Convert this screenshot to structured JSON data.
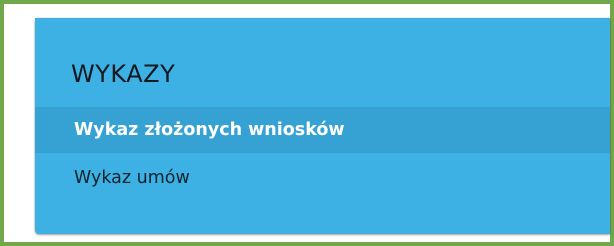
{
  "panel": {
    "title": "WYKAZY",
    "items": [
      {
        "label": "Wykaz złożonych wniosków",
        "active": true
      },
      {
        "label": "Wykaz umów",
        "active": false
      }
    ]
  },
  "colors": {
    "frame_border": "#72a84c",
    "panel_background": "#3db1e4",
    "active_item_background": "#35a2d3",
    "active_item_text": "#ffffff",
    "text": "#111820"
  }
}
